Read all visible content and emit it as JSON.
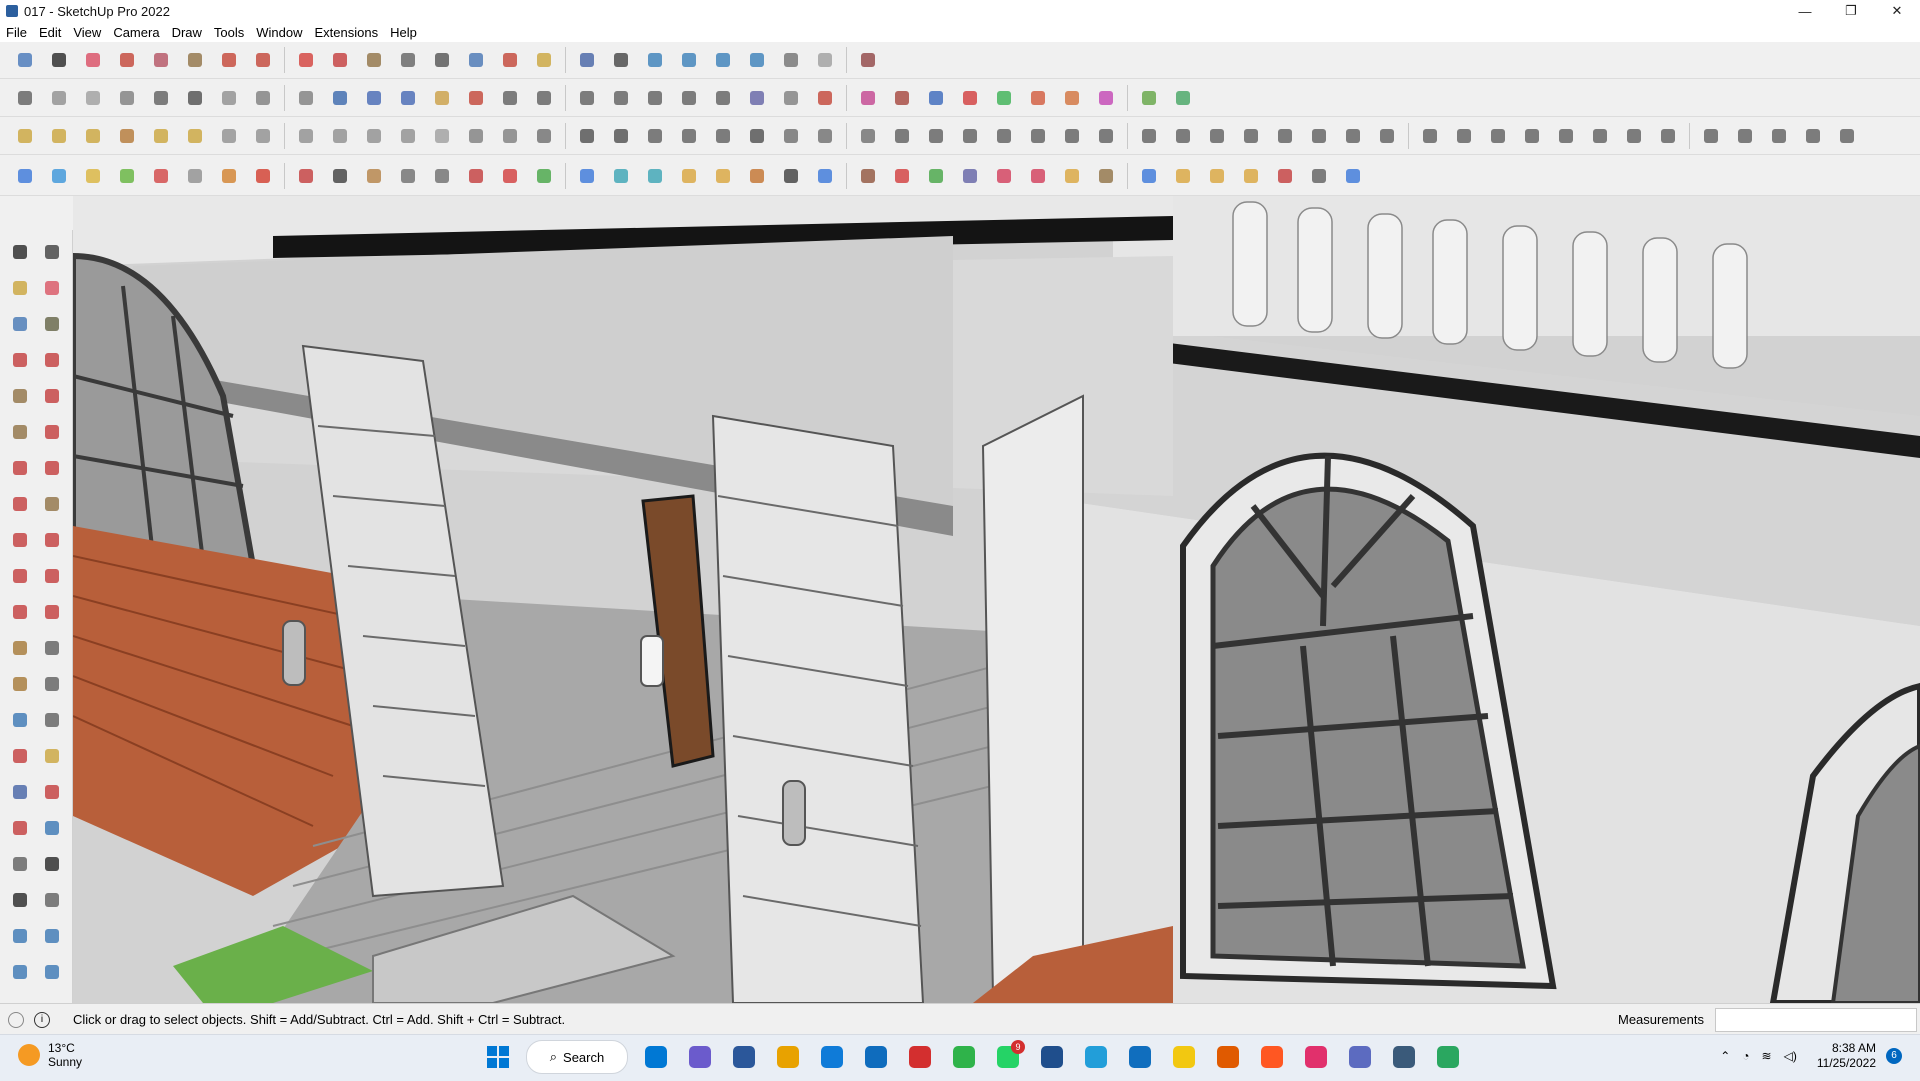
{
  "window": {
    "title": "017 - SketchUp Pro 2022",
    "minimize": "—",
    "maximize": "❐",
    "close": "✕"
  },
  "menu": [
    "File",
    "Edit",
    "View",
    "Camera",
    "Draw",
    "Tools",
    "Window",
    "Extensions",
    "Help"
  ],
  "toolbar_colors": {
    "row1": [
      "#3b6fb6",
      "#1a1a1a",
      "#d8425a",
      "#c0392b",
      "#b0485a",
      "#8a6a3a",
      "#c23a2a",
      "#c0392b",
      "#d2342f",
      "#c23030",
      "#8a6a3a",
      "#5a5a5a",
      "#4a4a4a",
      "#3c6db0",
      "#c0392b",
      "#c8a030",
      "#3a5aa0",
      "#3a3a3a",
      "#2e78b5",
      "#2e78b5",
      "#2e78b5",
      "#2e78b5",
      "#6a6a6a",
      "#9a9a9a",
      "#8a3a3a"
    ],
    "row2": [
      "#555555",
      "#888888",
      "#999999",
      "#777777",
      "#555555",
      "#444444",
      "#888888",
      "#777777",
      "#777777",
      "#2e5fa8",
      "#3a5fb0",
      "#3a5fb0",
      "#c89a3a",
      "#c0392b",
      "#555555",
      "#555555",
      "#555555",
      "#555555",
      "#555555",
      "#555555",
      "#555555",
      "#5a5aa0",
      "#777777",
      "#c0392b",
      "#c03a8a",
      "#a03a30",
      "#2e5fb8",
      "#d03030",
      "#2fae4a",
      "#d05030",
      "#d06a30",
      "#c03ab0",
      "#5aa03a",
      "#3aa05a"
    ],
    "row3": [
      "#c8a030",
      "#c8a030",
      "#c8a030",
      "#b0702a",
      "#c8a030",
      "#c8a030",
      "#8a8a8a",
      "#888888",
      "#888888",
      "#888888",
      "#888888",
      "#888888",
      "#999999",
      "#777777",
      "#777777",
      "#666666",
      "#444444",
      "#444444",
      "#555555",
      "#555555",
      "#555555",
      "#444444",
      "#666666",
      "#666666",
      "#666666",
      "#555555",
      "#555555",
      "#555555",
      "#555555",
      "#555555",
      "#555555",
      "#555555",
      "#555555",
      "#555555",
      "#555555",
      "#555555",
      "#555555",
      "#555555",
      "#555555",
      "#555555",
      "#555555",
      "#555555",
      "#555555",
      "#555555",
      "#555555",
      "#555555",
      "#555555",
      "#555555",
      "#555555",
      "#555555",
      "#555555",
      "#555555",
      "#555555"
    ],
    "row4": [
      "#2e6fd8",
      "#2e8fd8",
      "#d8b030",
      "#5ab030",
      "#d03a3a",
      "#888888",
      "#d07a20",
      "#d03020",
      "#c03030",
      "#333333",
      "#b07a3a",
      "#666666",
      "#666666",
      "#c03030",
      "#d03030",
      "#3aa03a",
      "#2e6fd8",
      "#2e9fb0",
      "#2e9fb0",
      "#d8a030",
      "#d8a030",
      "#c06a20",
      "#333333",
      "#2e6fd8",
      "#8a4a30",
      "#d03030",
      "#3aa03a",
      "#5a5aa0",
      "#d03050",
      "#d03050",
      "#d8a030",
      "#8a6a3a",
      "#2e6fd8",
      "#d8a030",
      "#d8a030",
      "#d8a030",
      "#c03030",
      "#555555",
      "#2e6fd8"
    ]
  },
  "left_toolbar_colors": [
    "#1a1a1a",
    "#333333",
    "#c8a030",
    "#d84a5a",
    "#3a6fb0",
    "#5a5a3a",
    "#c03030",
    "#c03030",
    "#8a6a3a",
    "#c03030",
    "#8a6a3a",
    "#c03030",
    "#c03030",
    "#c03030",
    "#c03030",
    "#8a6a3a",
    "#c03030",
    "#c03030",
    "#c03030",
    "#c03030",
    "#c03030",
    "#c03030",
    "#a0702a",
    "#555555",
    "#a0702a",
    "#555555",
    "#2e6fb0",
    "#555555",
    "#c03030",
    "#c8a030",
    "#3a5aa0",
    "#c03030",
    "#c03030",
    "#2e6fb0",
    "#555555",
    "#1a1a1a",
    "#1a1a1a",
    "#555555",
    "#2e6fb0",
    "#2e6fb0",
    "#2e6fb0",
    "#2e6fb0"
  ],
  "status": {
    "hint": "Click or drag to select objects. Shift = Add/Subtract. Ctrl = Add. Shift + Ctrl = Subtract.",
    "measurements_label": "Measurements",
    "measurements_value": ""
  },
  "taskbar": {
    "weather_temp": "13°C",
    "weather_desc": "Sunny",
    "search_label": "Search",
    "whatsapp_badge": "9",
    "time": "8:38 AM",
    "date": "11/25/2022",
    "notif_count": "6",
    "app_colors": [
      "#0078d4",
      "#6b5bcc",
      "#2b579a",
      "#e8a200",
      "#0f7bd8",
      "#0f6cbd",
      "#d32f2f",
      "#2fb34a",
      "#25d366",
      "#1f4e8c",
      "#229ed9",
      "#106ebe",
      "#f2c811",
      "#e05a00",
      "#ff5722",
      "#e1306c",
      "#5c6bc0",
      "#3a5a7a",
      "#2aa760"
    ]
  }
}
